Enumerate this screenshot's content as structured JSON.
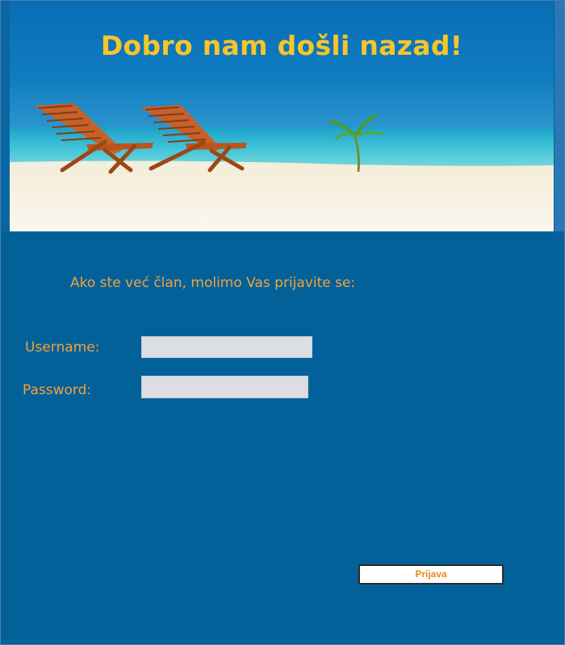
{
  "header": {
    "title": "Dobro nam došli nazad!"
  },
  "login": {
    "prompt": "Ako ste već član, molimo Vas prijavite se:",
    "username_label": "Username:",
    "password_label": "Password:",
    "username_value": "",
    "password_value": "",
    "submit_label": "Prijava"
  },
  "colors": {
    "background": "#03619a",
    "title": "#f6c52a",
    "label": "#f2a23a",
    "input_fill": "#dcdee2",
    "button_text": "#e98a1f"
  }
}
